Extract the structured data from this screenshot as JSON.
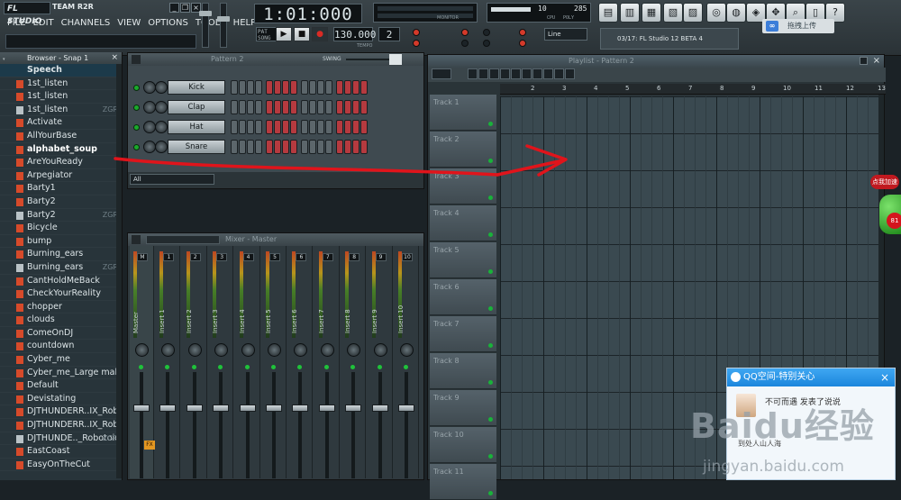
{
  "app": {
    "logo": "FL STUDIO",
    "team": "TEAM R2R",
    "time": "1:01:000",
    "tempo": "130.000",
    "tempo_label": "TEMPO",
    "cpu": "10",
    "poly": "285",
    "ram": "",
    "cpu_label": "CPU",
    "poly_label": "POLY",
    "snap_select": "Line",
    "hint": "03/17: FL Studio 12 BETA 4",
    "monitor_label": "MONITOR"
  },
  "menu": [
    "FILE",
    "EDIT",
    "CHANNELS",
    "VIEW",
    "OPTIONS",
    "TOOLS",
    "HELP"
  ],
  "upload": {
    "label": "拖拽上传"
  },
  "browser": {
    "title": "Browser - Snap 1",
    "items": [
      {
        "label": "Speech",
        "type": "folder",
        "zgr": ""
      },
      {
        "label": "1st_listen",
        "type": "sound",
        "zgr": ""
      },
      {
        "label": "1st_listen",
        "type": "sound",
        "zgr": ""
      },
      {
        "label": "1st_listen",
        "type": "zgr",
        "zgr": "ZGR"
      },
      {
        "label": "Activate",
        "type": "sound",
        "zgr": ""
      },
      {
        "label": "AllYourBase",
        "type": "sound",
        "zgr": ""
      },
      {
        "label": "alphabet_soup",
        "type": "sound",
        "zgr": ""
      },
      {
        "label": "AreYouReady",
        "type": "sound",
        "zgr": ""
      },
      {
        "label": "Arpegiator",
        "type": "sound",
        "zgr": ""
      },
      {
        "label": "Barty1",
        "type": "sound",
        "zgr": ""
      },
      {
        "label": "Barty2",
        "type": "sound",
        "zgr": ""
      },
      {
        "label": "Barty2",
        "type": "zgr",
        "zgr": "ZGR"
      },
      {
        "label": "Bicycle",
        "type": "sound",
        "zgr": ""
      },
      {
        "label": "bump",
        "type": "sound",
        "zgr": ""
      },
      {
        "label": "Burning_ears",
        "type": "sound",
        "zgr": ""
      },
      {
        "label": "Burning_ears",
        "type": "zgr",
        "zgr": "ZGR"
      },
      {
        "label": "CantHoldMeBack",
        "type": "sound",
        "zgr": ""
      },
      {
        "label": "CheckYourReality",
        "type": "sound",
        "zgr": ""
      },
      {
        "label": "chopper",
        "type": "sound",
        "zgr": ""
      },
      {
        "label": "clouds",
        "type": "sound",
        "zgr": ""
      },
      {
        "label": "ComeOnDJ",
        "type": "sound",
        "zgr": ""
      },
      {
        "label": "countdown",
        "type": "sound",
        "zgr": ""
      },
      {
        "label": "Cyber_me",
        "type": "sound",
        "zgr": ""
      },
      {
        "label": "Cyber_me_Large male",
        "type": "sound",
        "zgr": ""
      },
      {
        "label": "Default",
        "type": "sound",
        "zgr": ""
      },
      {
        "label": "Devistating",
        "type": "sound",
        "zgr": ""
      },
      {
        "label": "DJTHUNDERR..IX_Robotoid",
        "type": "sound",
        "zgr": ""
      },
      {
        "label": "DJTHUNDERR..IX_Robotoid",
        "type": "sound",
        "zgr": ""
      },
      {
        "label": "DJTHUNDE.._Robotoid",
        "type": "zgr",
        "zgr": "ZGR"
      },
      {
        "label": "EastCoast",
        "type": "sound",
        "zgr": ""
      },
      {
        "label": "EasyOnTheCut",
        "type": "sound",
        "zgr": ""
      }
    ]
  },
  "rack": {
    "title": "Pattern 2",
    "swing_label": "SWING",
    "filter": "All",
    "channels": [
      {
        "name": "Kick"
      },
      {
        "name": "Clap"
      },
      {
        "name": "Hat"
      },
      {
        "name": "Snare"
      }
    ]
  },
  "mixer": {
    "title": "Mixer - Master",
    "strips": [
      "Master",
      "Insert 1",
      "Insert 2",
      "Insert 3",
      "Insert 4",
      "Insert 5",
      "Insert 6",
      "Insert 7",
      "Insert 8",
      "Insert 9",
      "Insert 10"
    ],
    "numbers": [
      "M",
      "1",
      "2",
      "3",
      "4",
      "5",
      "6",
      "7",
      "8",
      "9",
      "10"
    ],
    "fx_label": "FX"
  },
  "playlist": {
    "title": "Playlist - Pattern 2",
    "tracks": [
      "Track 1",
      "Track 2",
      "Track 3",
      "Track 4",
      "Track 5",
      "Track 6",
      "Track 7",
      "Track 8",
      "Track 9",
      "Track 10",
      "Track 11"
    ],
    "ruler": [
      "2",
      "3",
      "4",
      "5",
      "6",
      "7",
      "8",
      "9",
      "10",
      "11",
      "12",
      "13"
    ]
  },
  "qq": {
    "title": "QQ空间-特别关心",
    "text": "不可而遇 发表了说说",
    "sub": "到处人山人海"
  },
  "overlay": {
    "hot_badge": "点我加速",
    "ball_num": "81"
  },
  "colors": {
    "step_red": "#b53a3f",
    "step_grey": "#5c666b",
    "annotation_red": "#e0141b",
    "green_led": "#1ba82c"
  },
  "watermark": {
    "brand": "Baidu经验",
    "url": "jingyan.baidu.com"
  }
}
